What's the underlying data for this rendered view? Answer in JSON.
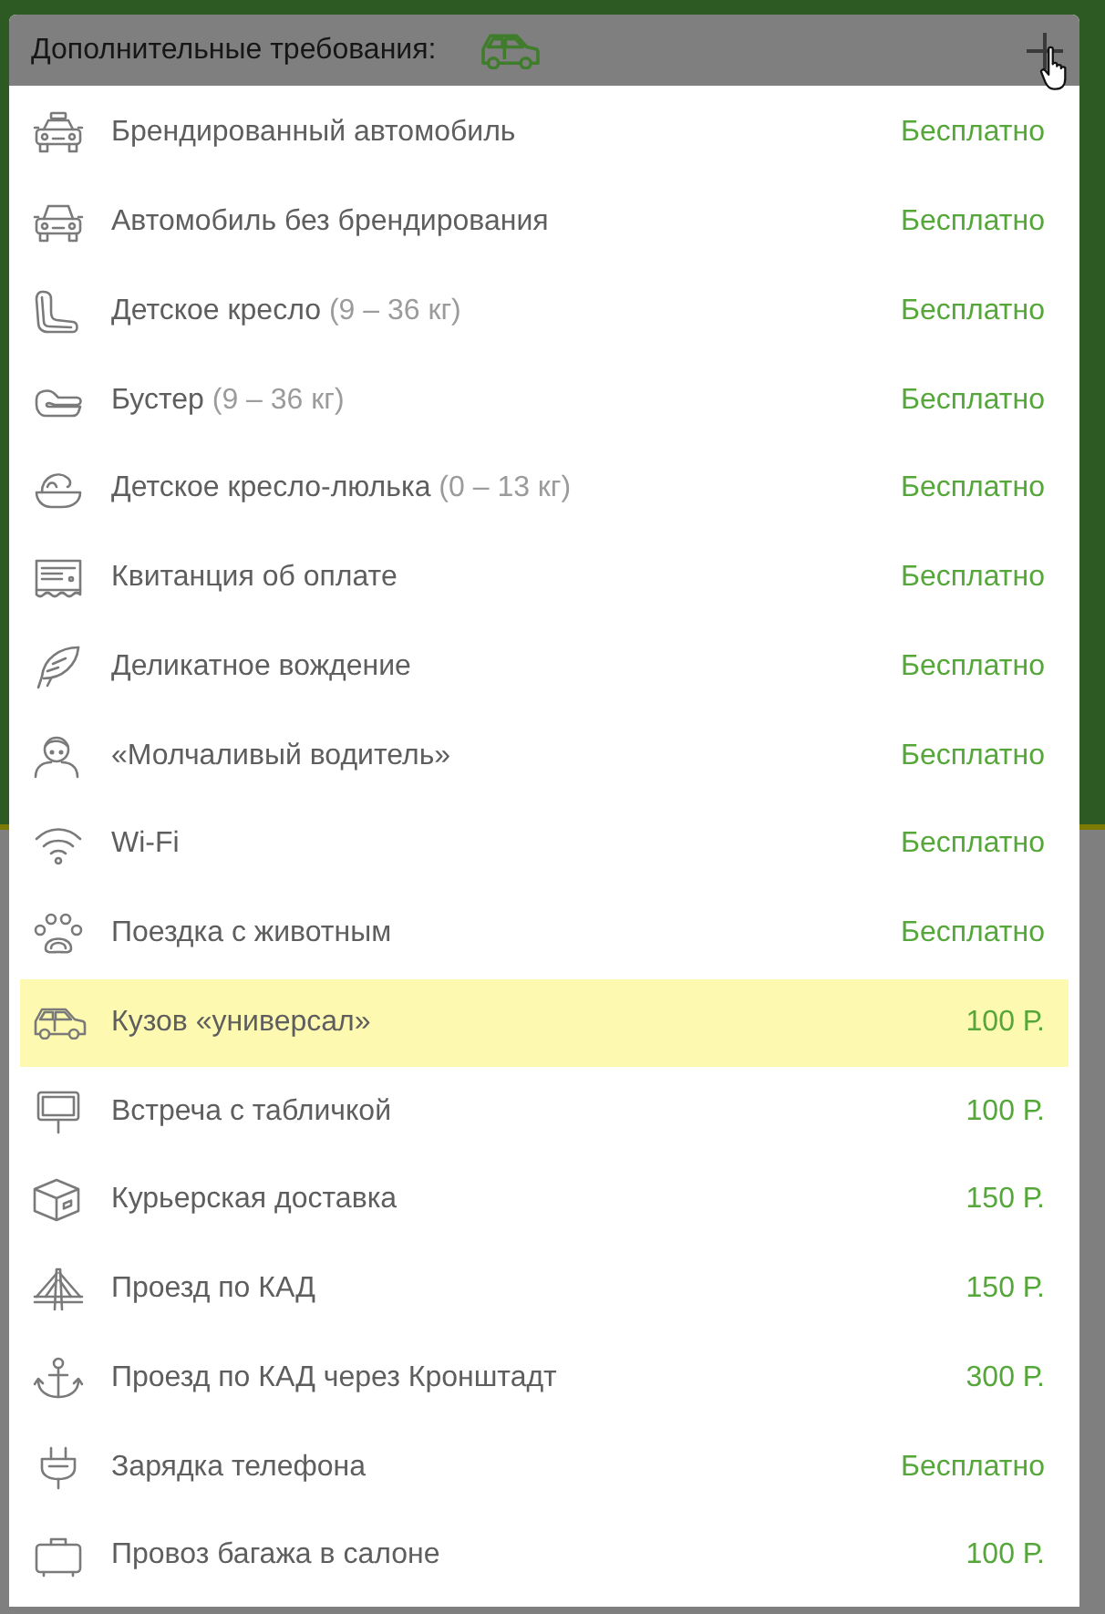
{
  "panel": {
    "title": "Дополнительные требования:"
  },
  "options": [
    {
      "label": "Брендированный автомобиль",
      "price": "Бесплатно",
      "selected": false
    },
    {
      "label": "Автомобиль без брендирования",
      "price": "Бесплатно",
      "selected": false
    },
    {
      "label": "Детское кресло",
      "note": "(9 – 36 кг)",
      "price": "Бесплатно",
      "selected": false
    },
    {
      "label": "Бустер",
      "note": "(9 – 36 кг)",
      "price": "Бесплатно",
      "selected": false
    },
    {
      "label": "Детское кресло-люлька",
      "note": "(0 – 13 кг)",
      "price": "Бесплатно",
      "selected": false
    },
    {
      "label": "Квитанция об оплате",
      "price": "Бесплатно",
      "selected": false
    },
    {
      "label": "Деликатное вождение",
      "price": "Бесплатно",
      "selected": false
    },
    {
      "label": "«Молчаливый водитель»",
      "price": "Бесплатно",
      "selected": false
    },
    {
      "label": "Wi-Fi",
      "price": "Бесплатно",
      "selected": false
    },
    {
      "label": "Поездка с животным",
      "price": "Бесплатно",
      "selected": false
    },
    {
      "label": "Кузов «универсал»",
      "price": "100 Р.",
      "selected": true
    },
    {
      "label": "Встреча с табличкой",
      "price": "100 Р.",
      "selected": false
    },
    {
      "label": "Курьерская доставка",
      "price": "150 Р.",
      "selected": false
    },
    {
      "label": "Проезд по КАД",
      "price": "150 Р.",
      "selected": false
    },
    {
      "label": "Проезд по КАД через Кронштадт",
      "price": "300 Р.",
      "selected": false
    },
    {
      "label": "Зарядка телефона",
      "price": "Бесплатно",
      "selected": false
    },
    {
      "label": "Провоз багажа в салоне",
      "price": "100 Р.",
      "selected": false
    }
  ]
}
